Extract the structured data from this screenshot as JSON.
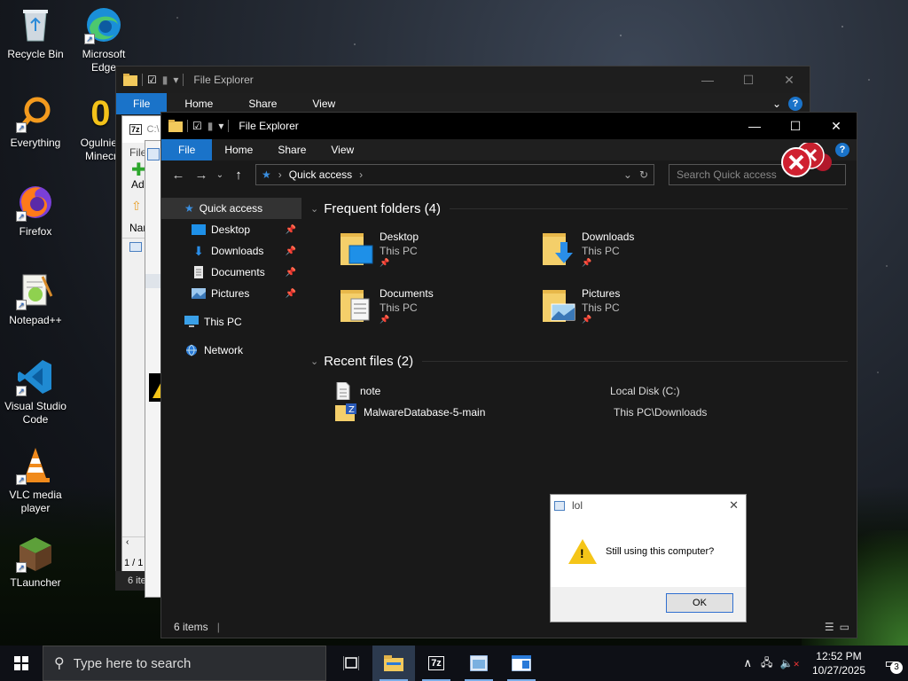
{
  "desktop": {
    "icons": [
      {
        "label": "Recycle Bin",
        "icon": "recycle-bin-icon"
      },
      {
        "label": "Microsoft Edge",
        "icon": "edge-icon"
      },
      {
        "label": "Everything",
        "icon": "everything-search-icon"
      },
      {
        "label": "Ogulnie Minecr",
        "icon": "shortcut-icon"
      },
      {
        "label": "Firefox",
        "icon": "firefox-icon"
      },
      {
        "label": "Notepad++",
        "icon": "notepadpp-icon"
      },
      {
        "label": "Visual Studio Code",
        "icon": "vscode-icon"
      },
      {
        "label": "VLC media player",
        "icon": "vlc-icon"
      },
      {
        "label": "TLauncher",
        "icon": "tlauncher-icon"
      }
    ]
  },
  "back_explorer": {
    "title": "File Explorer",
    "tabs": [
      "File",
      "Home",
      "Share",
      "View"
    ]
  },
  "mid_window": {
    "title_frag": "C:\\",
    "file_frag": "File",
    "add_frag": "Ad",
    "name_frag": "Nam",
    "status_frag": "1 / 1",
    "items_frag": "6 ite"
  },
  "front_explorer": {
    "title": "File Explorer",
    "tabs": [
      "File",
      "Home",
      "Share",
      "View"
    ],
    "help": "?",
    "address": {
      "location": "Quick access",
      "separator": "›"
    },
    "search_placeholder": "Search Quick access",
    "nav": [
      {
        "label": "Quick access",
        "icon": "star-icon",
        "selected": true
      },
      {
        "label": "Desktop",
        "icon": "desktop-folder-icon",
        "pinned": true
      },
      {
        "label": "Downloads",
        "icon": "download-arrow-icon",
        "pinned": true
      },
      {
        "label": "Documents",
        "icon": "documents-icon",
        "pinned": true
      },
      {
        "label": "Pictures",
        "icon": "pictures-icon",
        "pinned": true
      },
      {
        "label": "This PC",
        "icon": "monitor-icon"
      },
      {
        "label": "Network",
        "icon": "network-icon"
      }
    ],
    "frequent_header": "Frequent folders (4)",
    "frequent": [
      {
        "name": "Desktop",
        "location": "This PC"
      },
      {
        "name": "Downloads",
        "location": "This PC"
      },
      {
        "name": "Documents",
        "location": "This PC"
      },
      {
        "name": "Pictures",
        "location": "This PC"
      }
    ],
    "recent_header": "Recent files (2)",
    "recent": [
      {
        "name": "note",
        "location": "Local Disk (C:)"
      },
      {
        "name": "MalwareDatabase-5-main",
        "location": "This PC\\Downloads"
      }
    ],
    "status": "6 items"
  },
  "dialog": {
    "title": "lol",
    "message": "Still using this computer?",
    "ok": "OK"
  },
  "taskbar": {
    "search_placeholder": "Type here to search",
    "time": "12:52 PM",
    "date": "10/27/2025",
    "notifications": "3"
  }
}
